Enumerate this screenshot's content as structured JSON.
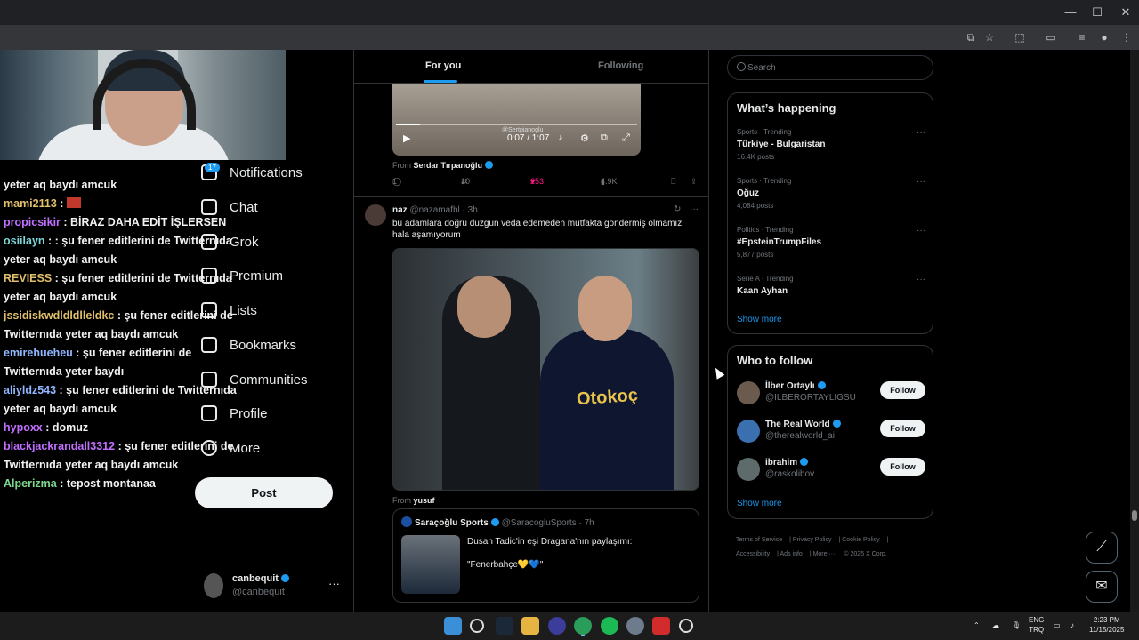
{
  "browser": {
    "window_controls": [
      "—",
      "☐",
      "✕"
    ]
  },
  "chat": [
    {
      "user": "",
      "msg": "yeter aq baydı amcuk",
      "color": "#ffffff"
    },
    {
      "user": "mami2113",
      "msg": " : ",
      "color": "#e0c06a",
      "emote": true
    },
    {
      "user": "propicsikir",
      "msg": " : BİRAZ DAHA EDİT İŞLERSEN",
      "color": "#c070ff"
    },
    {
      "user": "osiilayn",
      "msg": " : : şu fener editlerini de Twitternıda yeter aq baydı amcuk",
      "color": "#7fd7d7"
    },
    {
      "user": "REVIESS",
      "msg": " : şu fener editlerini de Twitternıda yeter aq baydı amcuk",
      "color": "#e0c06a"
    },
    {
      "user": "jssidiskwdldldlleldkc",
      "msg": " : şu fener editlerini de Twitternıda yeter aq baydı amcuk",
      "color": "#e0c06a"
    },
    {
      "user": "emirehueheu",
      "msg": " : şu fener editlerini de Twitternıda yeter baydı",
      "color": "#8fb6ff"
    },
    {
      "user": "aliyldz543",
      "msg": " : şu fener editlerini de Twitternıda yeter aq baydı amcuk",
      "color": "#8fb6ff"
    },
    {
      "user": "hypoxx",
      "msg": " : domuz",
      "color": "#c070ff"
    },
    {
      "user": "blackjackrandall3312",
      "msg": " : şu fener editlerini de Twitternıda yeter aq baydı amcuk",
      "color": "#c070ff"
    },
    {
      "user": "Alperizma",
      "msg": " : tepost montanaa",
      "color": "#7fd78f"
    }
  ],
  "nav": {
    "notifications_badge": "17",
    "items": [
      "Notifications",
      "Chat",
      "Grok",
      "Premium",
      "Lists",
      "Bookmarks",
      "Communities",
      "Profile",
      "More"
    ],
    "post_label": "Post",
    "account": {
      "name": "canbequit",
      "handle": "@canbequit"
    }
  },
  "timeline": {
    "tabs": [
      "For you",
      "Following"
    ],
    "video": {
      "time": "0:07 / 1:07",
      "watermark": "@Sertpianoglu"
    },
    "from1_label": "From",
    "from1_name": "Serdar Tırpanoğlu",
    "actions": {
      "replies": "1",
      "reposts": "10",
      "likes": "253",
      "views": "4.9K"
    },
    "tweet": {
      "name": "naz",
      "meta": "@nazamafbl · 3h",
      "text": "bu adamlara doğru düzgün veda edemeden mutfakta göndermiş olmamız hala aşamıyorum",
      "photo_brand": "Otokoç"
    },
    "from2_label": "From",
    "from2_name": "yusuf",
    "quote": {
      "name": "Saraçoğlu Sports",
      "meta": "@SaracogluSports · 7h",
      "line1": "Dusan Tadic'in eşi Dragana'nın paylaşımı:",
      "line2": "\"Fenerbahçe💛💙\""
    }
  },
  "sidebar": {
    "search_placeholder": "Search",
    "happening_title": "What’s happening",
    "trends": [
      {
        "meta": "Sports · Trending",
        "name": "Türkiye - Bulgaristan",
        "count": "16.4K posts"
      },
      {
        "meta": "Sports · Trending",
        "name": "Oğuz",
        "count": "4,084 posts"
      },
      {
        "meta": "Politics · Trending",
        "name": "#EpsteinTrumpFiles",
        "count": "5,877 posts"
      },
      {
        "meta": "Serie A · Trending",
        "name": "Kaan Ayhan",
        "count": ""
      }
    ],
    "show_more": "Show more",
    "wtf_title": "Who to follow",
    "follow_label": "Follow",
    "who_to_follow": [
      {
        "name": "İlber Ortaylı",
        "handle": "@ILBERORTAYLIGSU"
      },
      {
        "name": "The Real World",
        "handle": "@therealworld_ai"
      },
      {
        "name": "ibrahim",
        "handle": "@raskolibov"
      }
    ],
    "footer": [
      "Terms of Service",
      "Privacy Policy",
      "Cookie Policy",
      "Accessibility",
      "Ads info",
      "More ···",
      "© 2025 X Corp."
    ]
  },
  "taskbar": {
    "lang": "ENG",
    "lang2": "TRQ",
    "time": "2:23 PM",
    "date": "11/15/2025"
  },
  "colors": {
    "accent": "#1d9bf0",
    "like": "#f91880"
  }
}
